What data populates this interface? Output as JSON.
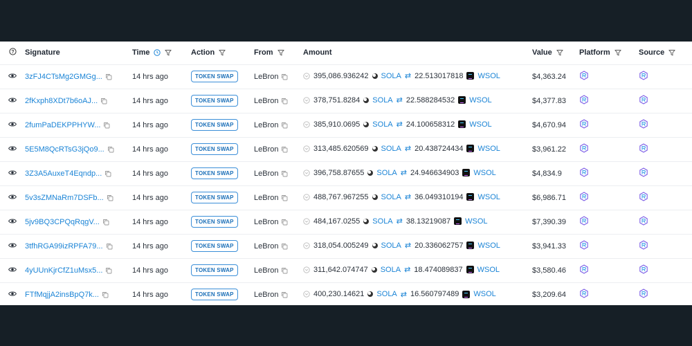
{
  "headers": {
    "info_icon": "question-circle",
    "signature": "Signature",
    "time": "Time",
    "action": "Action",
    "from": "From",
    "amount": "Amount",
    "value": "Value",
    "platform": "Platform",
    "source": "Source"
  },
  "colors": {
    "link": "#1b84d6",
    "badge_border": "#3a8ed8",
    "frame": "#161f26",
    "platform_icon": "#7b5ce6"
  },
  "rows": [
    {
      "signature": "3zFJ4CTsMg2GMGg...",
      "time": "14 hrs ago",
      "action": "TOKEN SWAP",
      "from": "LeBron",
      "amount_in": "395,086.936242",
      "token_in": "SOLA",
      "amount_out": "22.513017818",
      "token_out": "WSOL",
      "value": "$4,363.24"
    },
    {
      "signature": "2fKxph8XDt7b6oAJ...",
      "time": "14 hrs ago",
      "action": "TOKEN SWAP",
      "from": "LeBron",
      "amount_in": "378,751.8284",
      "token_in": "SOLA",
      "amount_out": "22.588284532",
      "token_out": "WSOL",
      "value": "$4,377.83"
    },
    {
      "signature": "2fumPaDEKPPHYW...",
      "time": "14 hrs ago",
      "action": "TOKEN SWAP",
      "from": "LeBron",
      "amount_in": "385,910.0695",
      "token_in": "SOLA",
      "amount_out": "24.100658312",
      "token_out": "WSOL",
      "value": "$4,670.94"
    },
    {
      "signature": "5E5M8QcRTsG3jQo9...",
      "time": "14 hrs ago",
      "action": "TOKEN SWAP",
      "from": "LeBron",
      "amount_in": "313,485.620569",
      "token_in": "SOLA",
      "amount_out": "20.438724434",
      "token_out": "WSOL",
      "value": "$3,961.22"
    },
    {
      "signature": "3Z3A5AuxeT4Eqndp...",
      "time": "14 hrs ago",
      "action": "TOKEN SWAP",
      "from": "LeBron",
      "amount_in": "396,758.87655",
      "token_in": "SOLA",
      "amount_out": "24.946634903",
      "token_out": "WSOL",
      "value": "$4,834.9"
    },
    {
      "signature": "5v3sZMNaRm7DSFb...",
      "time": "14 hrs ago",
      "action": "TOKEN SWAP",
      "from": "LeBron",
      "amount_in": "488,767.967255",
      "token_in": "SOLA",
      "amount_out": "36.049310194",
      "token_out": "WSOL",
      "value": "$6,986.71"
    },
    {
      "signature": "5jv9BQ3CPQqRqgV...",
      "time": "14 hrs ago",
      "action": "TOKEN SWAP",
      "from": "LeBron",
      "amount_in": "484,167.0255",
      "token_in": "SOLA",
      "amount_out": "38.13219087",
      "token_out": "WSOL",
      "value": "$7,390.39"
    },
    {
      "signature": "3tfhRGA99izRPFA79...",
      "time": "14 hrs ago",
      "action": "TOKEN SWAP",
      "from": "LeBron",
      "amount_in": "318,054.005249",
      "token_in": "SOLA",
      "amount_out": "20.336062757",
      "token_out": "WSOL",
      "value": "$3,941.33"
    },
    {
      "signature": "4yUUnKjrCfZ1uMsx5...",
      "time": "14 hrs ago",
      "action": "TOKEN SWAP",
      "from": "LeBron",
      "amount_in": "311,642.074747",
      "token_in": "SOLA",
      "amount_out": "18.474089837",
      "token_out": "WSOL",
      "value": "$3,580.46"
    },
    {
      "signature": "FTfMqjjA2insBpQ7k...",
      "time": "14 hrs ago",
      "action": "TOKEN SWAP",
      "from": "LeBron",
      "amount_in": "400,230.14621",
      "token_in": "SOLA",
      "amount_out": "16.560797489",
      "token_out": "WSOL",
      "value": "$3,209.64"
    }
  ]
}
